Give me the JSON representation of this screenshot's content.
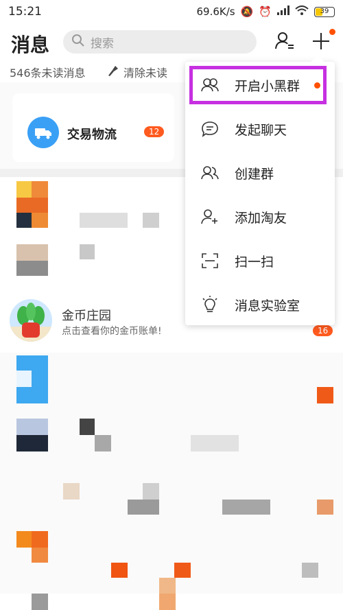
{
  "status_bar": {
    "time": "15:21",
    "network_speed": "69.6K/s",
    "battery": "39"
  },
  "header": {
    "title": "消息",
    "search_placeholder": "搜索"
  },
  "unread_bar": {
    "count_text": "546条未读消息",
    "clear_label": "清除未读"
  },
  "pinned": {
    "logistics_label": "交易物流",
    "logistics_badge": "12"
  },
  "coin_item": {
    "title": "金币庄园",
    "subtitle": "点击查看你的金币账单!",
    "badge": "16"
  },
  "menu": {
    "items": [
      {
        "label": "开启小黑群",
        "icon": "group-icon",
        "has_dot": true
      },
      {
        "label": "发起聊天",
        "icon": "chat-bubble-icon"
      },
      {
        "label": "创建群",
        "icon": "group-create-icon"
      },
      {
        "label": "添加淘友",
        "icon": "add-friend-icon"
      },
      {
        "label": "扫一扫",
        "icon": "scan-icon"
      },
      {
        "label": "消息实验室",
        "icon": "lightbulb-icon"
      }
    ]
  },
  "colors": {
    "accent": "#ff5000",
    "highlight": "#c630e0",
    "logistics_blue": "#3aa0f5"
  }
}
